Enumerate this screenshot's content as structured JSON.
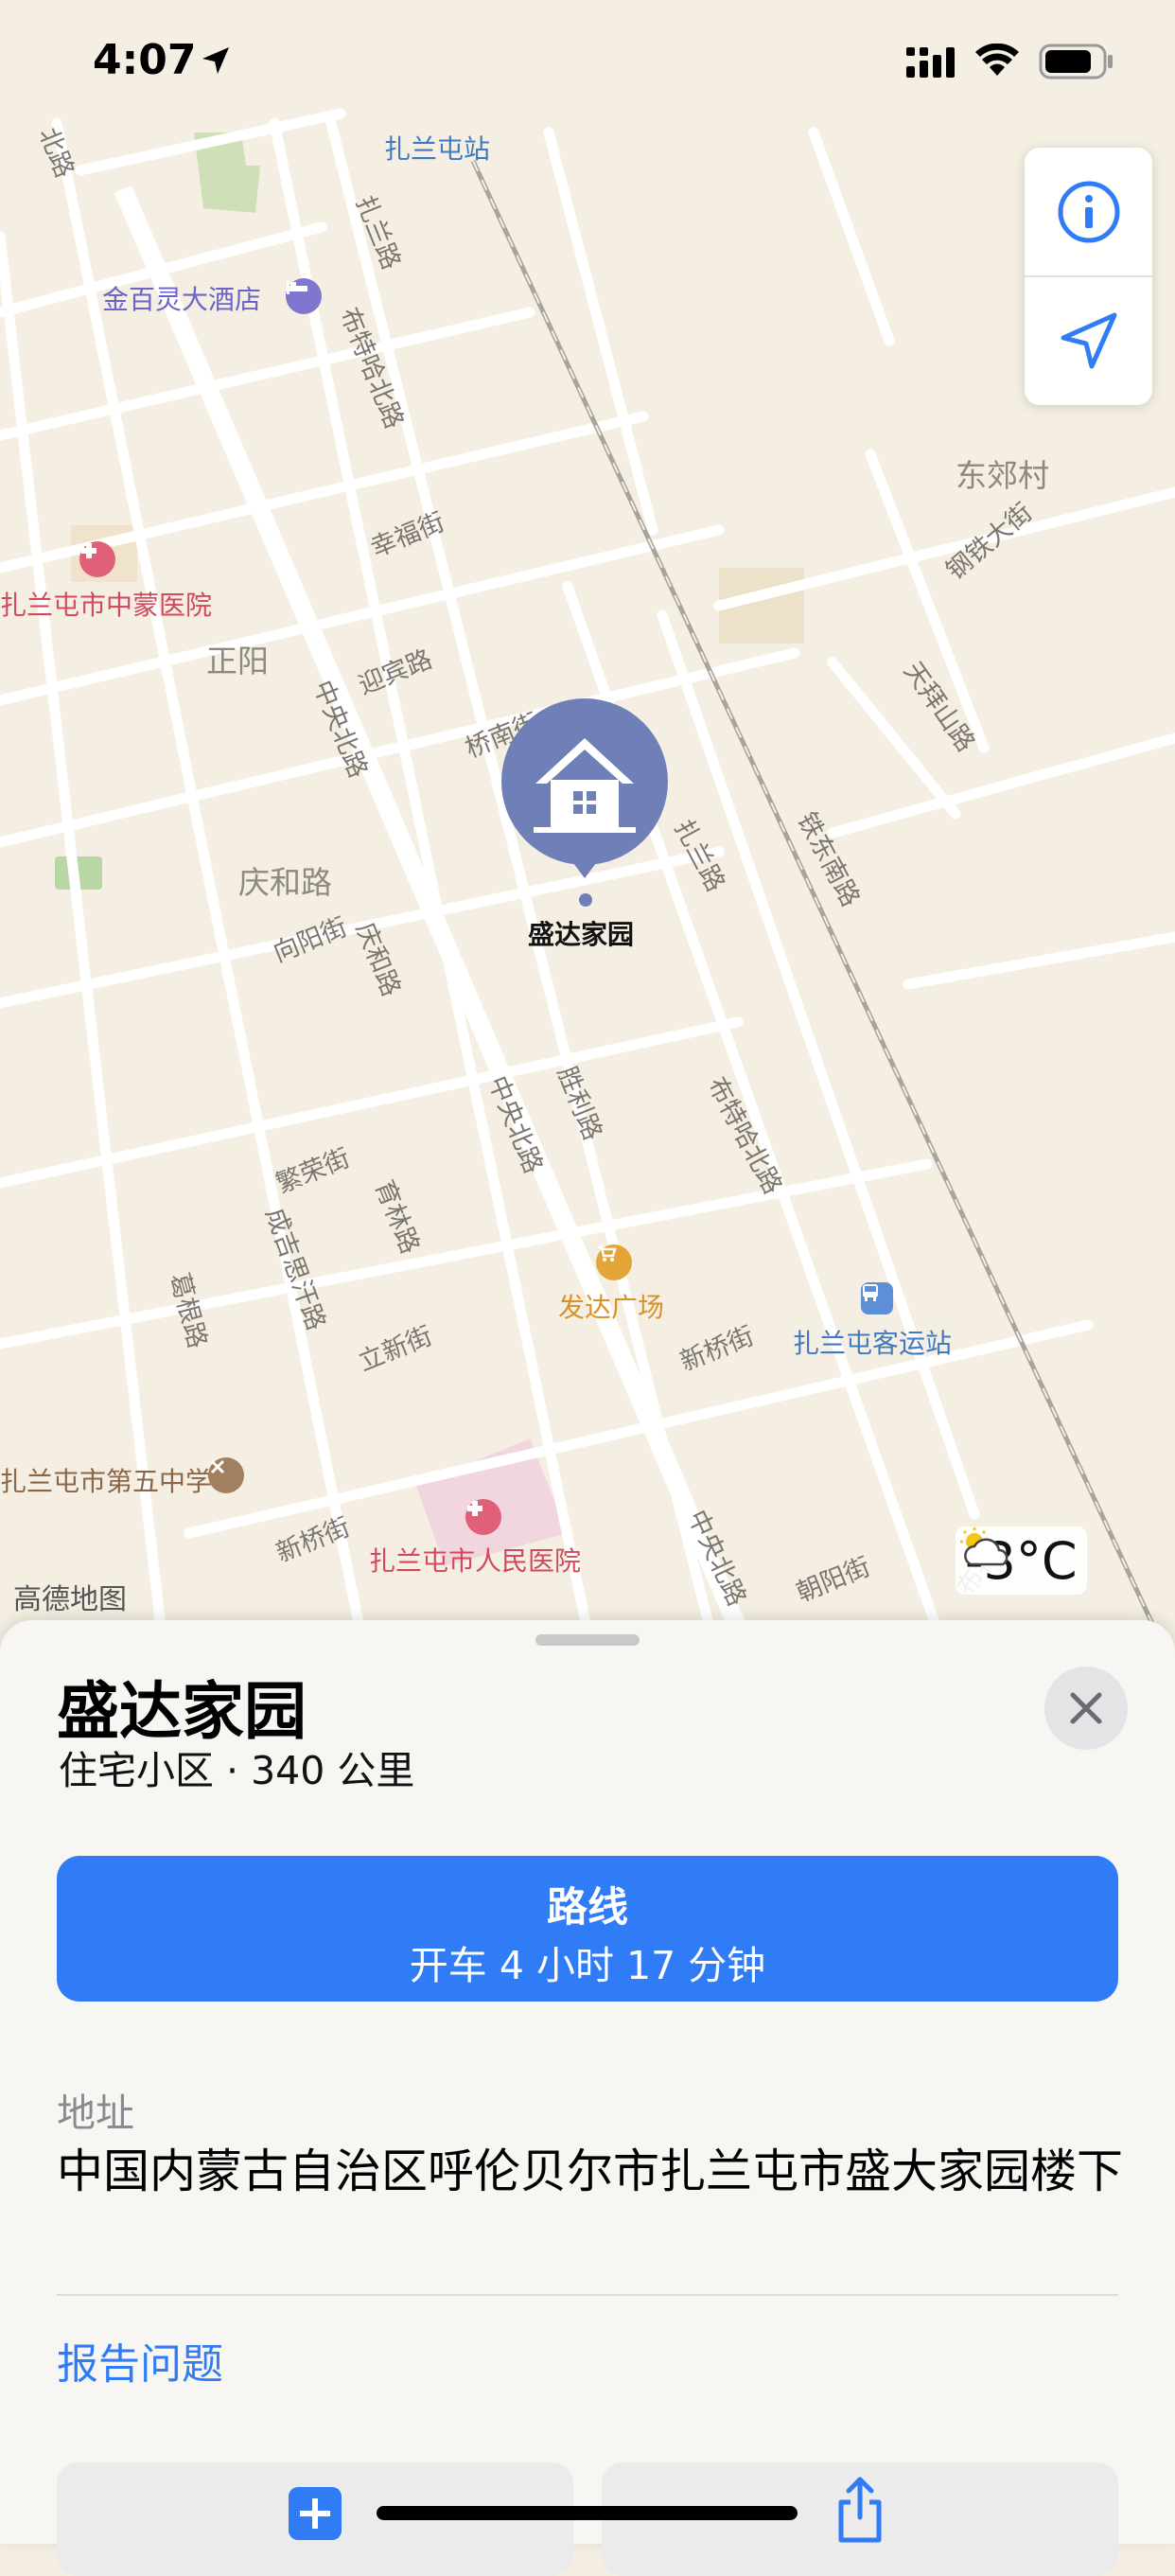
{
  "status_bar": {
    "time": "4:07"
  },
  "map": {
    "logo": "高德地图",
    "weather": {
      "temperature": "-3°C",
      "icon": "partly-cloudy-sun-icon"
    },
    "road_labels": [
      "北路",
      "扎兰路",
      "布特哈北路",
      "幸福街",
      "迎宾路",
      "桥南街",
      "中央北路",
      "扎兰路",
      "铁东南路",
      "钢铁大街",
      "天拜山路",
      "向阳街",
      "庆和路",
      "胜利路",
      "中央北路",
      "布特哈北路",
      "繁荣街",
      "育林路",
      "成吉思汗路",
      "葛根路",
      "立新街",
      "新桥街",
      "新桥街",
      "中央北路",
      "朝阳街",
      "布特"
    ],
    "area_labels": [
      "东郊村",
      "正阳",
      "庆和路"
    ],
    "pois": [
      {
        "name": "扎兰屯站",
        "color": "#3f79c2"
      },
      {
        "name": "金百灵大酒店",
        "color": "#6c63c8"
      },
      {
        "name": "扎兰屯市中蒙医院",
        "color": "#d2495c"
      },
      {
        "name": "发达广场",
        "color": "#d8922a"
      },
      {
        "name": "扎兰屯客运站",
        "color": "#3f79c2"
      },
      {
        "name": "扎兰屯市第五中学",
        "color": "#8b6547"
      },
      {
        "name": "扎兰屯市人民医院",
        "color": "#d2495c"
      }
    ],
    "pin": {
      "label": "盛达家园",
      "icon": "house-icon",
      "color": "#6f80b8"
    }
  },
  "sheet": {
    "title": "盛达家园",
    "subtitle": "住宅小区 · 340 公里",
    "route_button": {
      "title": "路线",
      "subtitle": "开车 4 小时 17 分钟"
    },
    "address_label": "地址",
    "address_value": "中国内蒙古自治区呼伦贝尔市扎兰屯市盛大家园楼下",
    "report_link": "报告问题"
  },
  "colors": {
    "accent": "#2f7cf6",
    "map_background": "#f4efe2"
  }
}
